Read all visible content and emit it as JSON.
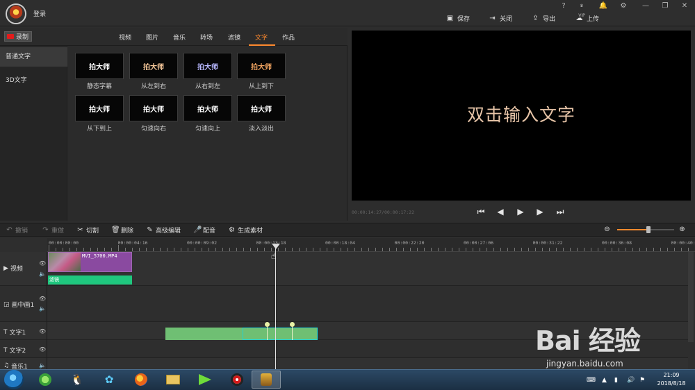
{
  "topbar": {
    "login": "登录",
    "actions": [
      {
        "label": "保存",
        "icon": "save-icon"
      },
      {
        "label": "关闭",
        "icon": "exit-icon"
      },
      {
        "label": "导出",
        "icon": "export-icon"
      },
      {
        "label": "上传",
        "icon": "upload-icon"
      }
    ],
    "window_icons": [
      "help-icon",
      "vip-icon",
      "bell-icon",
      "gear-icon",
      "minimize-icon",
      "restore-icon",
      "close-icon"
    ],
    "help_glyph": "?",
    "vip_text": "VIP"
  },
  "library": {
    "record_label": "录制",
    "tabs": [
      "视频",
      "图片",
      "音乐",
      "转场",
      "滤镜",
      "文字",
      "作品"
    ],
    "active_tab": "文字",
    "categories": [
      "普通文字",
      "3D文字"
    ],
    "selected_category": "普通文字",
    "items": [
      {
        "thumb_text": "拍大师",
        "label": "静态字幕",
        "color": "#ffffff"
      },
      {
        "thumb_text": "拍大师",
        "label": "从左到右",
        "color": "#f6c89a"
      },
      {
        "thumb_text": "拍大师",
        "label": "从右到左",
        "color": "#b8b8ff"
      },
      {
        "thumb_text": "拍大师",
        "label": "从上到下",
        "color": "#f2a561"
      },
      {
        "thumb_text": "拍大师",
        "label": "从下到上",
        "color": "#ffffff"
      },
      {
        "thumb_text": "拍大师",
        "label": "匀速向右",
        "color": "#ffffff"
      },
      {
        "thumb_text": "拍大师",
        "label": "匀速向上",
        "color": "#ffffff"
      },
      {
        "thumb_text": "拍大师",
        "label": "淡入淡出",
        "color": "#ffffff"
      }
    ]
  },
  "preview": {
    "text": "双击输入文字",
    "timecode": "00:00:14:27/00:00:17:22",
    "controls": [
      "skip-start-icon",
      "step-back-icon",
      "play-icon",
      "step-forward-icon",
      "skip-end-icon"
    ]
  },
  "toolbar": {
    "undo": "撤销",
    "redo": "重做",
    "cut": "切割",
    "delete": "删除",
    "advanced_edit": "高级编辑",
    "dub": "配音",
    "generate": "生成素材"
  },
  "timeline": {
    "ruler_labels": [
      "00:00:00:00",
      "00:00:04:16",
      "00:00:09:02",
      "00:00:13:18",
      "00:00:18:04",
      "00:00:22:20",
      "00:00:27:06",
      "00:00:31:22",
      "00:00:36:08",
      "00:00:40:"
    ],
    "tracks": [
      {
        "name": "视频",
        "icon": "video-track-icon"
      },
      {
        "name": "画中画1",
        "icon": "pip-track-icon"
      },
      {
        "name": "文字1",
        "icon": "text-track-icon"
      },
      {
        "name": "文字2",
        "icon": "text-track-icon"
      },
      {
        "name": "音乐1",
        "icon": "music-track-icon"
      }
    ],
    "video_clip": {
      "filename": "MVI_5700.MP4",
      "filter_label": "滤镜"
    },
    "colors": {
      "accent": "#ff8a2e",
      "video_clip": "#8a4aa0",
      "filter_bar": "#1fc77e",
      "text_clip": "#6fbf73",
      "selected_clip": "#22d3d3"
    }
  },
  "taskbar": {
    "apps": [
      "360-icon",
      "qq-icon",
      "media-player-icon",
      "firefox-icon",
      "explorer-icon",
      "video-app-icon",
      "recorder-icon",
      "paidashi-icon"
    ],
    "clock_time": "21:09",
    "clock_date": "2018/8/18"
  },
  "watermark": {
    "logo_text": "Bai 经验",
    "url": "jingyan.baidu.com"
  }
}
